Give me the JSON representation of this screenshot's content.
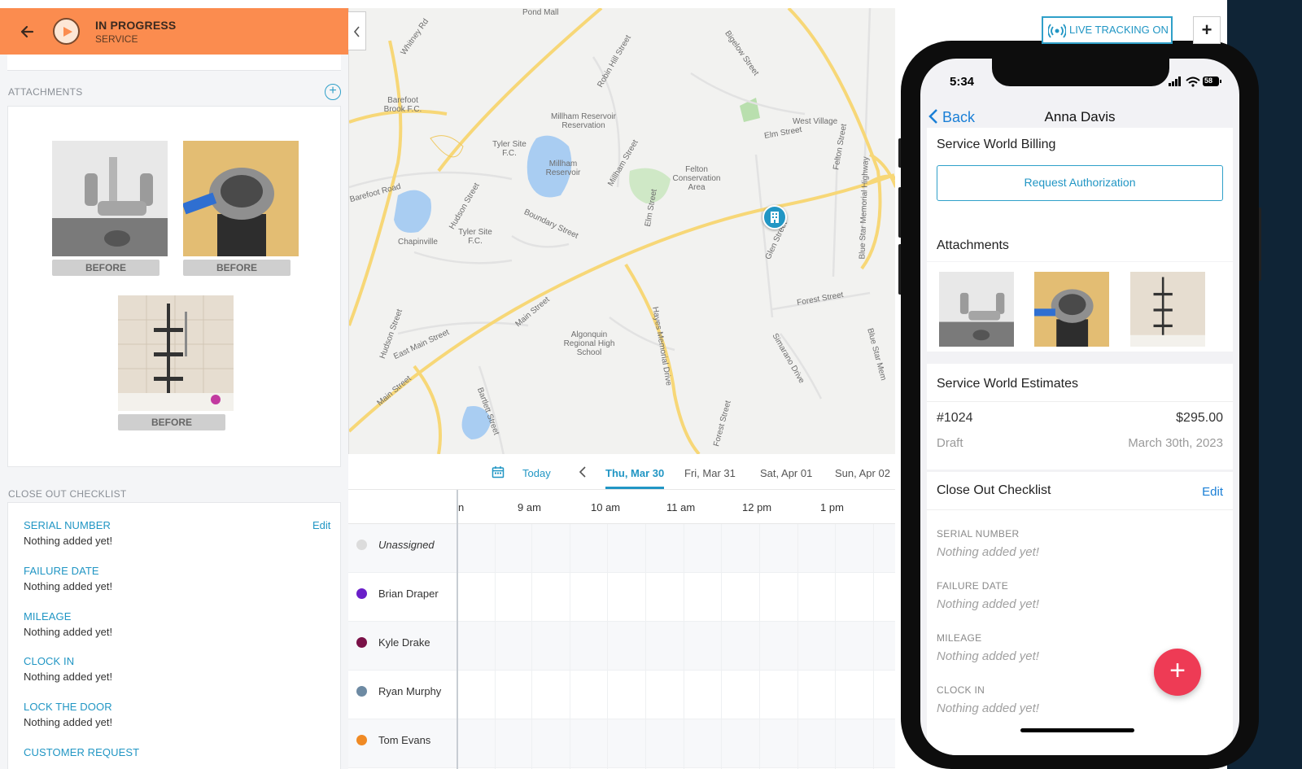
{
  "left": {
    "status_title": "IN PROGRESS",
    "status_sub": "SERVICE",
    "attachments_label": "ATTACHMENTS",
    "before_label": "BEFORE",
    "checklist_label": "CLOSE OUT CHECKLIST",
    "edit_label": "Edit",
    "checklist": [
      {
        "title": "SERIAL NUMBER",
        "value": "Nothing added yet!"
      },
      {
        "title": "FAILURE DATE",
        "value": "Nothing added yet!"
      },
      {
        "title": "MILEAGE",
        "value": "Nothing added yet!"
      },
      {
        "title": "CLOCK IN",
        "value": "Nothing added yet!"
      },
      {
        "title": "LOCK THE DOOR",
        "value": "Nothing added yet!"
      },
      {
        "title": "CUSTOMER REQUEST",
        "value": ""
      }
    ]
  },
  "map": {
    "live_tracking": "LIVE TRACKING ON",
    "plus": "+",
    "labels": [
      "Pond Mall",
      "Whitney Rd",
      "Robin Hill Street",
      "Bigelow Street",
      "Barefoot Brook F.C.",
      "Millham Reservoir Reservation",
      "Tyler Site F.C.",
      "Millham Reservoir",
      "Millham Street",
      "West Village",
      "Elm Street",
      "Felton Conservation Area",
      "Barefoot Road",
      "Hudson Street",
      "Boundary Street",
      "Chapinville",
      "Tyler Site F.C.",
      "Elm Street",
      "Glen Street",
      "Blue Star Memorial Highway",
      "Felton Street",
      "Forest Street",
      "Main Street",
      "Algonquin Regional High School",
      "Hayes Memorial Drive",
      "East Main Street",
      "Hudson Street",
      "Simarano Drive",
      "Main Street",
      "Bartlett Street",
      "Forest Street",
      "Blue Star Mem"
    ]
  },
  "scheduler": {
    "today": "Today",
    "days": [
      "Thu, Mar 30",
      "Fri, Mar 31",
      "Sat, Apr 01",
      "Sun, Apr 02"
    ],
    "active_day": "Thu, Mar 30",
    "times": [
      "n",
      "9 am",
      "10 am",
      "11 am",
      "12 pm",
      "1 pm"
    ],
    "resources": [
      {
        "name": "Unassigned",
        "color": "#dcdcdc"
      },
      {
        "name": "Brian Draper",
        "color": "#6a1fc9"
      },
      {
        "name": "Kyle Drake",
        "color": "#7a1147"
      },
      {
        "name": "Ryan Murphy",
        "color": "#6d8aa3"
      },
      {
        "name": "Tom Evans",
        "color": "#f08a24"
      }
    ]
  },
  "phone": {
    "time": "5:34",
    "battery": "58",
    "back": "Back",
    "title": "Anna Davis",
    "billing_title": "Service World Billing",
    "request_auth": "Request Authorization",
    "attachments_title": "Attachments",
    "estimates_title": "Service World Estimates",
    "estimate_number": "#1024",
    "estimate_amount": "$295.00",
    "estimate_status": "Draft",
    "estimate_date": "March 30th, 2023",
    "checklist_title": "Close Out Checklist",
    "edit": "Edit",
    "checklist": [
      {
        "title": "SERIAL NUMBER",
        "value": "Nothing added yet!"
      },
      {
        "title": "FAILURE DATE",
        "value": "Nothing added yet!"
      },
      {
        "title": "MILEAGE",
        "value": "Nothing added yet!"
      },
      {
        "title": "CLOCK IN",
        "value": "Nothing added yet!"
      }
    ],
    "fab": "+"
  },
  "colors": {
    "header_orange": "#fb8c4f",
    "accent_blue": "#2196c4",
    "fab_red": "#ee3b55"
  }
}
